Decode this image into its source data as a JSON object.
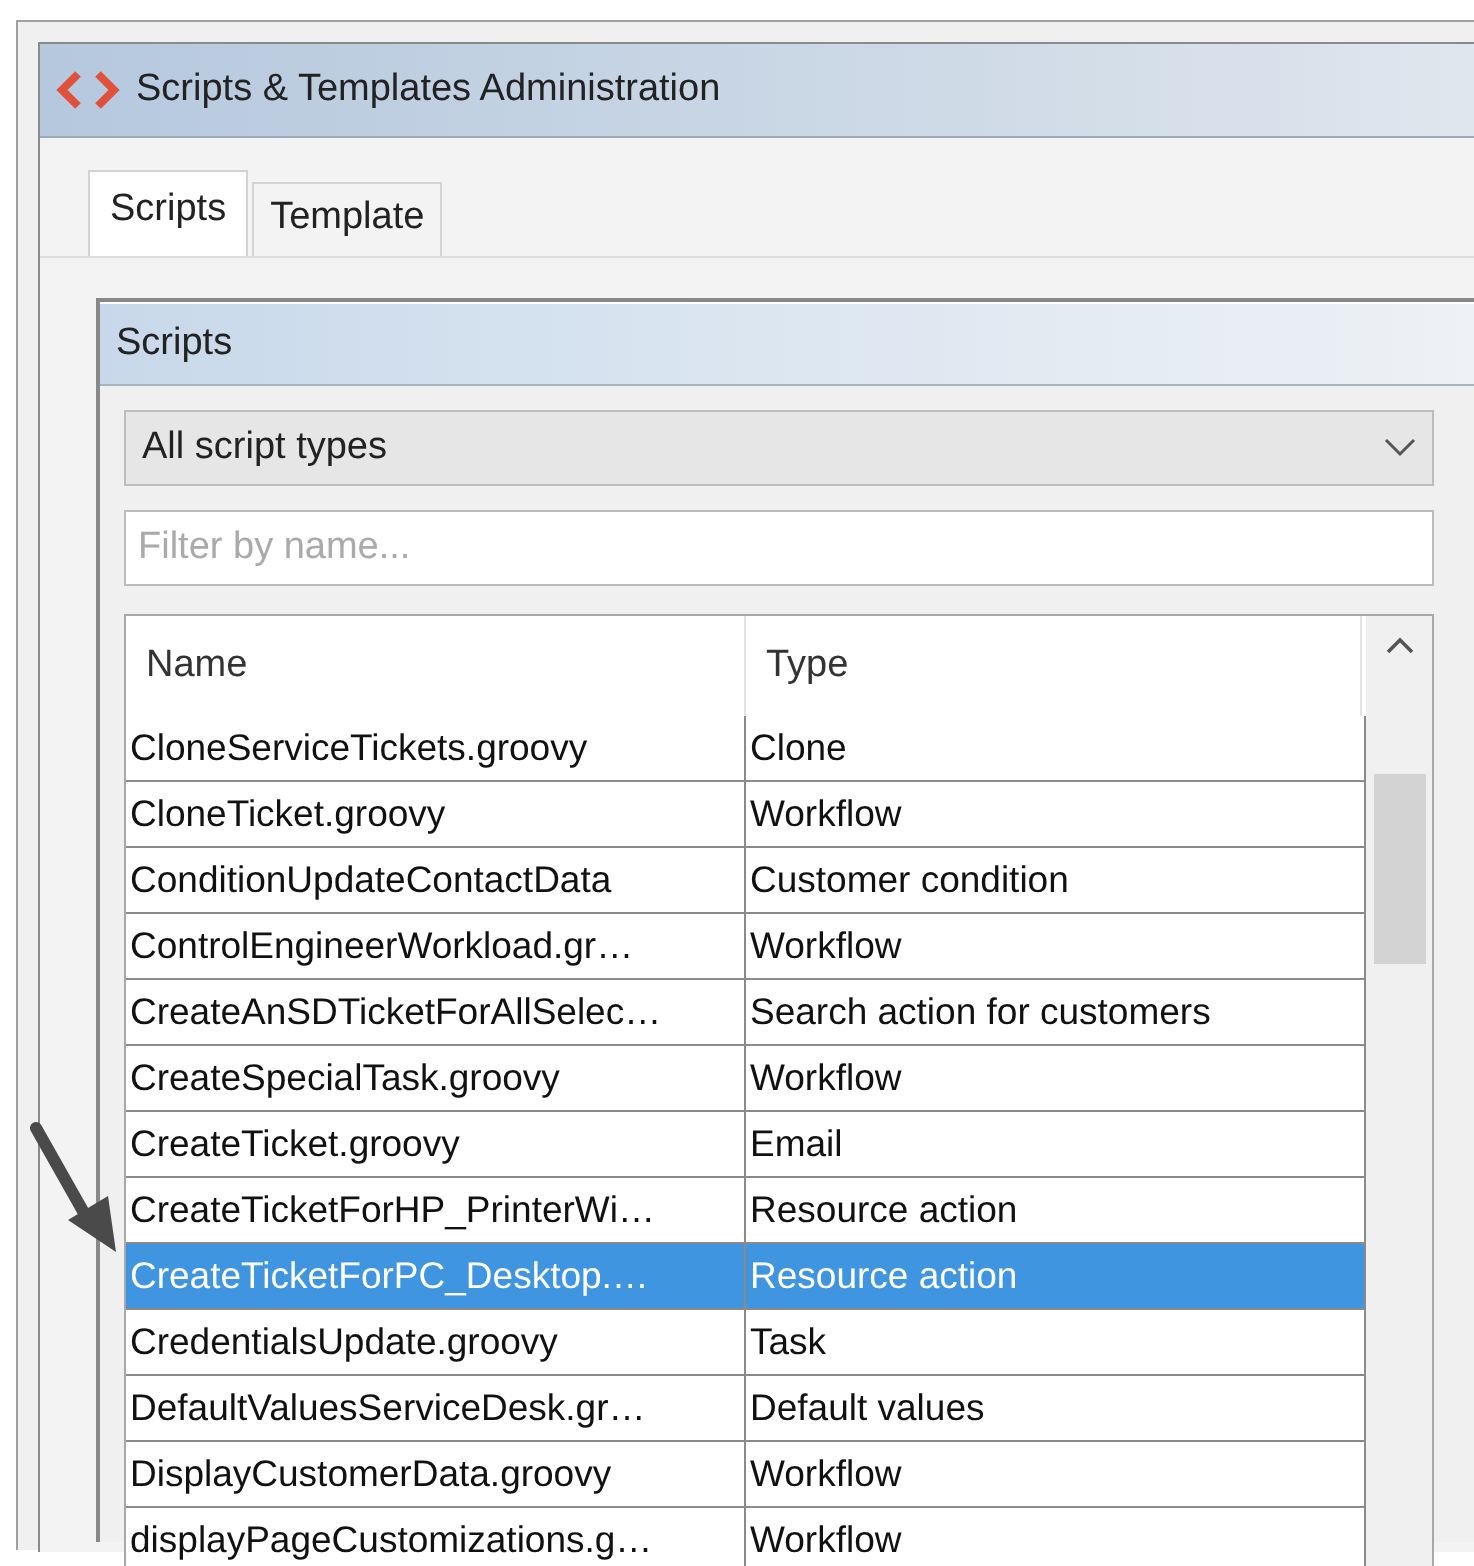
{
  "window": {
    "title": "Scripts & Templates Administration"
  },
  "tabs": [
    {
      "label": "Scripts",
      "selected": true
    },
    {
      "label": "Template",
      "selected": false
    }
  ],
  "panel": {
    "title": "Scripts",
    "type_filter": {
      "value": "All script types"
    },
    "search": {
      "placeholder": "Filter by name..."
    }
  },
  "table": {
    "columns": [
      "Name",
      "Type"
    ],
    "rows": [
      {
        "name": "CloneServiceTickets.groovy",
        "type": "Clone",
        "selected": false
      },
      {
        "name": "CloneTicket.groovy",
        "type": "Workflow",
        "selected": false
      },
      {
        "name": "ConditionUpdateContactData",
        "type": "Customer condition",
        "selected": false
      },
      {
        "name": "ControlEngineerWorkload.gr…",
        "type": "Workflow",
        "selected": false
      },
      {
        "name": "CreateAnSDTicketForAllSelec…",
        "type": "Search action for customers",
        "selected": false
      },
      {
        "name": "CreateSpecialTask.groovy",
        "type": "Workflow",
        "selected": false
      },
      {
        "name": "CreateTicket.groovy",
        "type": "Email",
        "selected": false
      },
      {
        "name": "CreateTicketForHP_PrinterWi…",
        "type": "Resource action",
        "selected": false
      },
      {
        "name": "CreateTicketForPC_Desktop.…",
        "type": "Resource action",
        "selected": true
      },
      {
        "name": "CredentialsUpdate.groovy",
        "type": "Task",
        "selected": false
      },
      {
        "name": "DefaultValuesServiceDesk.gr…",
        "type": "Default values",
        "selected": false
      },
      {
        "name": "DisplayCustomerData.groovy",
        "type": "Workflow",
        "selected": false
      },
      {
        "name": "displayPageCustomizations.g…",
        "type": "Workflow",
        "selected": false
      }
    ]
  }
}
